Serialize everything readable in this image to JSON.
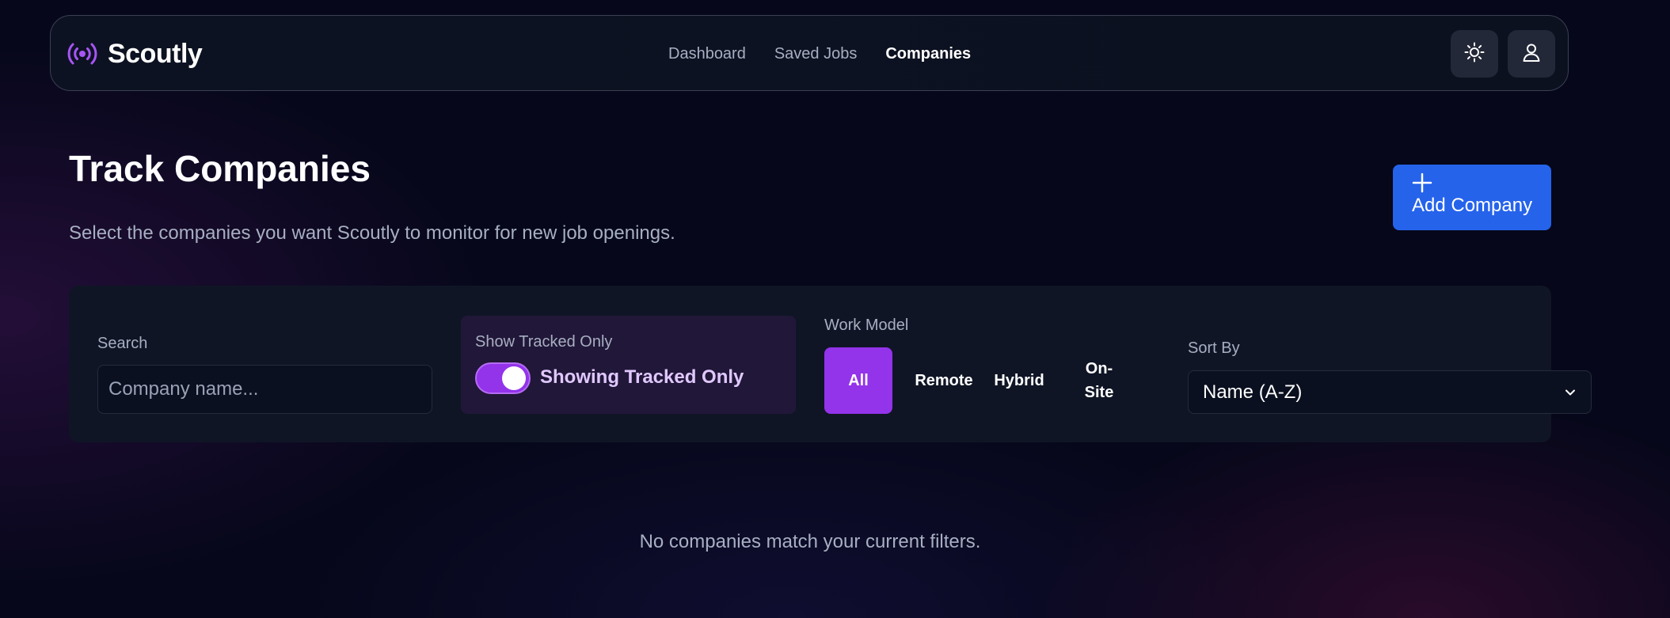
{
  "brand": {
    "name": "Scoutly",
    "icon": "broadcast-icon",
    "accent_color": "#a855f7"
  },
  "nav": {
    "links": [
      {
        "label": "Dashboard",
        "active": false
      },
      {
        "label": "Saved Jobs",
        "active": false
      },
      {
        "label": "Companies",
        "active": true
      }
    ],
    "theme_button_icon": "sun-icon",
    "profile_button_icon": "user-icon"
  },
  "page": {
    "title": "Track Companies",
    "subtitle": "Select the companies you want Scoutly to monitor for new job openings.",
    "add_button": {
      "label": "Add Company",
      "icon": "plus-icon",
      "color": "#2563eb"
    }
  },
  "filters": {
    "search": {
      "label": "Search",
      "placeholder": "Company name...",
      "value": ""
    },
    "tracked": {
      "label": "Show Tracked Only",
      "toggle_on": true,
      "status_text": "Showing Tracked Only"
    },
    "work_model": {
      "label": "Work Model",
      "options": [
        "All",
        "Remote",
        "Hybrid",
        "On-Site"
      ],
      "selected": "All",
      "selected_color": "#9333ea"
    },
    "sort": {
      "label": "Sort By",
      "value": "Name (A-Z)",
      "icon": "chevron-down-icon"
    }
  },
  "empty_state": {
    "message": "No companies match your current filters."
  }
}
